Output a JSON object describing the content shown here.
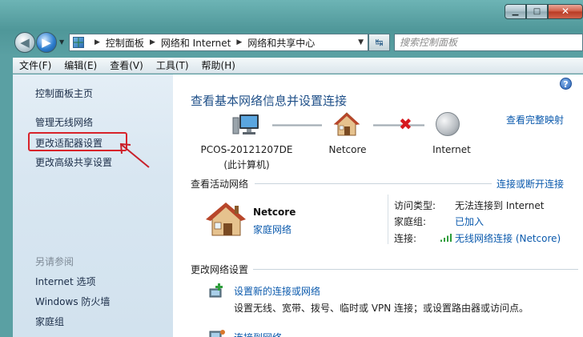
{
  "window": {
    "minimize_glyph": "▁",
    "maximize_glyph": "□",
    "close_glyph": "✕"
  },
  "nav": {
    "back_glyph": "◀",
    "forward_glyph": "▶",
    "dropdown_glyph": "▼",
    "breadcrumbs": [
      "控制面板",
      "网络和 Internet",
      "网络和共享中心"
    ],
    "breadcrumb_sep": "▶",
    "refresh_glyph": "↹",
    "search_placeholder": "搜索控制面板"
  },
  "menu": {
    "items": [
      "文件(F)",
      "编辑(E)",
      "查看(V)",
      "工具(T)",
      "帮助(H)"
    ]
  },
  "sidebar": {
    "home": "控制面板主页",
    "links": [
      "管理无线网络",
      "更改适配器设置",
      "更改高级共享设置"
    ],
    "see_also_title": "另请参阅",
    "see_also": [
      "Internet 选项",
      "Windows 防火墙",
      "家庭组"
    ]
  },
  "main": {
    "help_glyph": "?",
    "heading": "查看基本网络信息并设置连接",
    "view_full_map": "查看完整映射",
    "map": {
      "computer_name": "PCOS-20121207DE",
      "computer_sub": "(此计算机)",
      "network_name": "Netcore",
      "internet_name": "Internet",
      "broken_glyph": "✖"
    },
    "active": {
      "heading": "查看活动网络",
      "action_link": "连接或断开连接",
      "network_name": "Netcore",
      "network_type": "家庭网络",
      "props": [
        {
          "label": "访问类型:",
          "value": "无法连接到 Internet"
        },
        {
          "label": "家庭组:",
          "value": "已加入"
        },
        {
          "label": "连接:",
          "value": "无线网络连接 (Netcore)"
        }
      ]
    },
    "change": {
      "heading": "更改网络设置",
      "setup_link": "设置新的连接或网络",
      "setup_desc": "设置无线、宽带、拨号、临时或 VPN 连接；或设置路由器或访问点。",
      "connect_link": "连接到网络"
    }
  },
  "colors": {
    "link": "#0b5aad",
    "heading": "#1e4f88",
    "highlight": "#d8232a"
  }
}
